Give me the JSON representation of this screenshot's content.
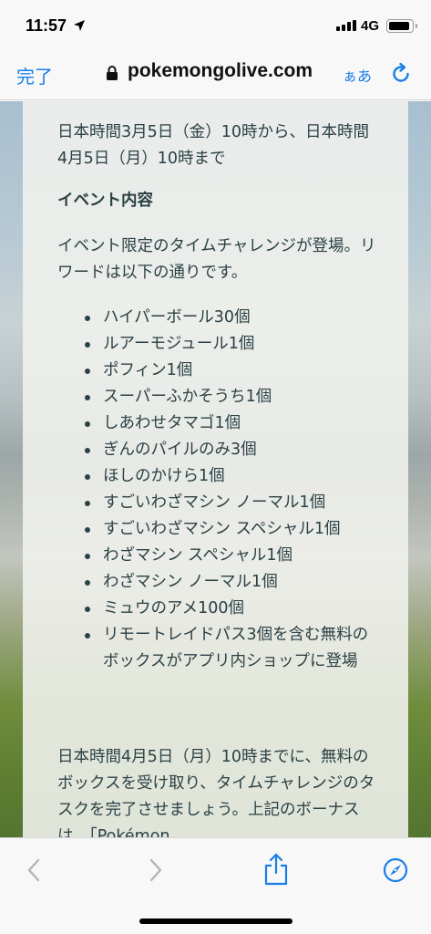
{
  "status_bar": {
    "time": "11:57",
    "network": "4G",
    "icons": [
      "location-arrow-icon",
      "cellular-signal-icon",
      "battery-icon"
    ]
  },
  "address_bar": {
    "done_label": "完了",
    "url": "pokemongolive.com",
    "text_size_label": "ぁあ",
    "icons": [
      "lock-icon",
      "reload-icon"
    ]
  },
  "article": {
    "date_range": "日本時間3月5日（金）10時から、日本時間4月5日（月）10時まで",
    "heading": "イベント内容",
    "intro": "イベント限定のタイムチャレンジが登場。リワードは以下の通りです。",
    "rewards": [
      "ハイパーボール30個",
      "ルアーモジュール1個",
      "ポフィン1個",
      "スーパーふかそうち1個",
      "しあわせタマゴ1個",
      "ぎんのパイルのみ3個",
      "ほしのかけら1個",
      "すごいわざマシン ノーマル1個",
      "すごいわざマシン スペシャル1個",
      "わざマシン スペシャル1個",
      "わざマシン ノーマル1個",
      "ミュウのアメ100個",
      "リモートレイドパス3個を含む無料のボックスがアプリ内ショップに登場"
    ],
    "outro": "日本時間4月5日（月）10時までに、無料のボックスを受け取り、タイムチャレンジのタスクを完了させましょう。上記のボーナスは、「Pokémon"
  },
  "toolbar": {
    "icons": [
      "back-chevron-icon",
      "forward-chevron-icon",
      "share-icon",
      "compass-icon"
    ]
  },
  "colors": {
    "accent": "#1a7ee8",
    "body_text": "#2b4146",
    "disabled": "#b5b5b5"
  }
}
